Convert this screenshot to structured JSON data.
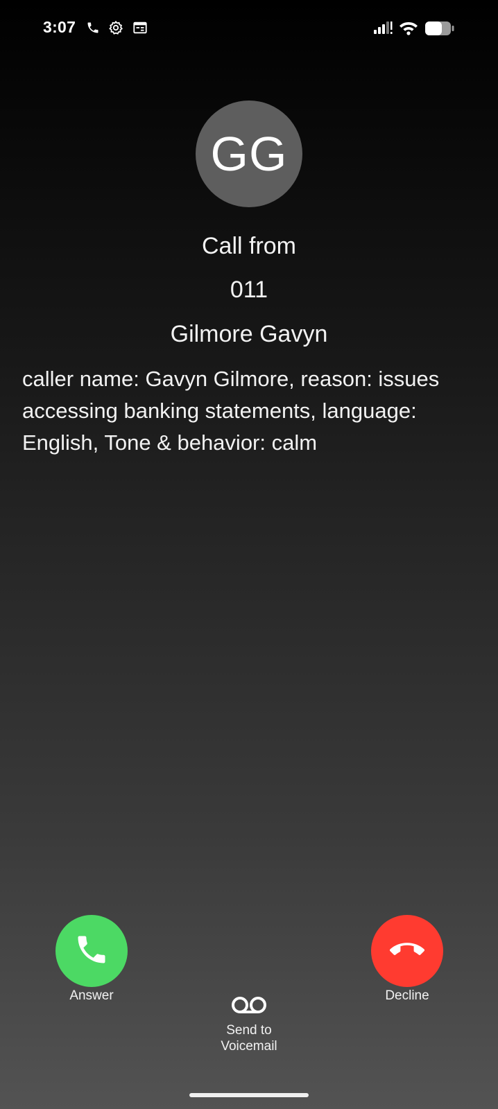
{
  "status_bar": {
    "time": "3:07",
    "left_icons": [
      "phone-icon",
      "gear-icon",
      "calendar-icon"
    ],
    "right_icons": [
      "signal-icon",
      "wifi-icon",
      "battery-icon"
    ]
  },
  "caller": {
    "initials": "GG",
    "heading": "Call from",
    "number": "011",
    "name": "Gilmore Gavyn",
    "details": "caller name: Gavyn Gilmore, reason: issues accessing banking statements, language: English, Tone & behavior: calm"
  },
  "actions": {
    "answer_label": "Answer",
    "decline_label": "Decline",
    "voicemail_line1": "Send to",
    "voicemail_line2": "Voicemail"
  },
  "colors": {
    "answer": "#4cd964",
    "decline": "#ff3b30",
    "avatar": "#5e5e5e"
  }
}
